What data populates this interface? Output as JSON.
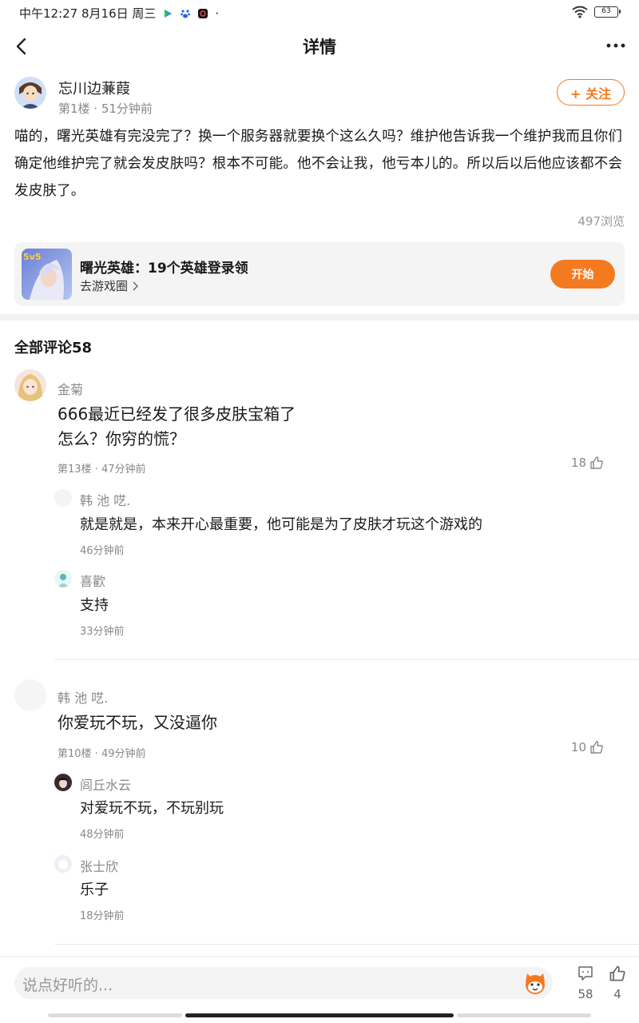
{
  "status_bar": {
    "time": "中午12:27 8月16日 周三",
    "dot": "·",
    "battery": "63"
  },
  "nav": {
    "title": "详情"
  },
  "post": {
    "author": "忘川边蒹葭",
    "meta": "第1楼 · 51分钟前",
    "follow_label": "+ 关注",
    "body": "喵的，曙光英雄有完没完了？换一个服务器就要换个这么久吗？维护他告诉我一个维护我而且你们确定他维护完了就会发皮肤吗？根本不可能。他不会让我，他亏本儿的。所以后以后他应该都不会发皮肤了。",
    "views": "497浏览"
  },
  "game_card": {
    "badge": "5v5",
    "title": "曙光英雄：19个英雄登录领",
    "link": "去游戏圈",
    "start_label": "开始"
  },
  "comments_header": "全部评论58",
  "comments": [
    {
      "author": "金菊",
      "text_lines": [
        "666最近已经发了很多皮肤宝箱了",
        "怎么？你穷的慌？"
      ],
      "meta": "第13楼 · 47分钟前",
      "likes": "18",
      "replies": [
        {
          "author": "韩 池 呓.",
          "text": "就是就是，本来开心最重要，他可能是为了皮肤才玩这个游戏的",
          "time": "46分钟前"
        },
        {
          "author": "喜歡",
          "text": "支持",
          "time": "33分钟前"
        }
      ]
    },
    {
      "author": "韩 池 呓.",
      "text_lines": [
        "你爱玩不玩，又没逼你"
      ],
      "meta": "第10楼 · 49分钟前",
      "likes": "10",
      "replies": [
        {
          "author": "闾丘水云",
          "text": "对爱玩不玩，不玩别玩",
          "time": "48分钟前"
        },
        {
          "author": "张士欣",
          "text": "乐子",
          "time": "18分钟前"
        }
      ]
    }
  ],
  "bottom_bar": {
    "placeholder": "说点好听的...",
    "comment_count": "58",
    "like_count": "4"
  },
  "colors": {
    "accent": "#f47a20",
    "muted": "#888888"
  }
}
